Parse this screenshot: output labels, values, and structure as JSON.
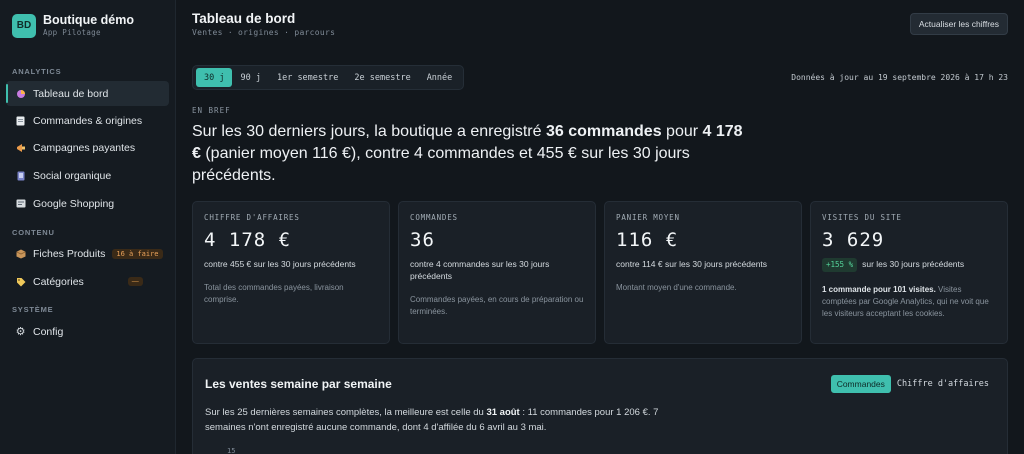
{
  "brand": {
    "logo": "BD",
    "name": "Boutique démo",
    "subtitle": "App Pilotage"
  },
  "sidebar": {
    "sections": {
      "analytics": "ANALYTICS",
      "contenu": "CONTENU",
      "systeme": "SYSTÈME"
    },
    "items": [
      {
        "label": "Tableau de bord",
        "icon": "dashboard-icon"
      },
      {
        "label": "Commandes & origines",
        "icon": "document-icon"
      },
      {
        "label": "Campagnes payantes",
        "icon": "megaphone-icon"
      },
      {
        "label": "Social organique",
        "icon": "social-icon"
      },
      {
        "label": "Google Shopping",
        "icon": "shopping-icon"
      },
      {
        "label": "Fiches Produits",
        "icon": "box-icon",
        "badge": "16 à faire"
      },
      {
        "label": "Catégories",
        "icon": "tag-icon",
        "badge": "—"
      },
      {
        "label": "Config",
        "icon": "gear-icon"
      }
    ]
  },
  "header": {
    "title": "Tableau de bord",
    "breadcrumb": "Ventes · origines · parcours",
    "refresh_label": "Actualiser les chiffres"
  },
  "range": {
    "options": [
      "30 j",
      "90 j",
      "1er semestre",
      "2e semestre",
      "Année"
    ],
    "selected": "30 j"
  },
  "updated": "Données à jour au 19 septembre 2026 à 17 h 23",
  "bref": {
    "label": "EN BREF",
    "t1": "Sur les 30 derniers jours, la boutique a enregistré ",
    "b1": "36 commandes",
    "t2": " pour ",
    "b2": "4 178 €",
    "t3": " (panier moyen 116 €), contre 4 commandes et 455 € sur les 30 jours précédents."
  },
  "cards": [
    {
      "label": "CHIFFRE D'AFFAIRES",
      "value": "4 178 €",
      "comparison": "contre 455 € sur les 30 jours précédents",
      "note": "Total des commandes payées, livraison comprise."
    },
    {
      "label": "COMMANDES",
      "value": "36",
      "comparison": "contre 4 commandes sur les 30 jours précédents",
      "note": "Commandes payées, en cours de préparation ou terminées."
    },
    {
      "label": "PANIER MOYEN",
      "value": "116 €",
      "comparison": "contre 114 € sur les 30 jours précédents",
      "note": "Montant moyen d'une commande."
    },
    {
      "label": "VISITES DU SITE",
      "value": "3 629",
      "delta": "+155 %",
      "comparison": "sur les 30 jours précédents",
      "note_bold": "1 commande pour 101 visites.",
      "note": " Visites comptées par Google Analytics, qui ne voit que les visiteurs acceptant les cookies."
    }
  ],
  "weekly": {
    "title": "Les ventes semaine par semaine",
    "toggle": [
      "Commandes",
      "Chiffre d'affaires"
    ],
    "selected": "Commandes",
    "t1": "Sur les 25 dernières semaines complètes, la meilleure est celle du ",
    "b1": "31 août",
    "t2": " : 11 commandes pour 1 206 €. 7 semaines n'ont enregistré aucune commande, dont 4 d'affilée du 6 avril au 3 mai.",
    "axis_top": "15"
  },
  "colors": {
    "accent": "#3fbfae",
    "positive": "#55d39a",
    "warning": "#e9a25a"
  }
}
